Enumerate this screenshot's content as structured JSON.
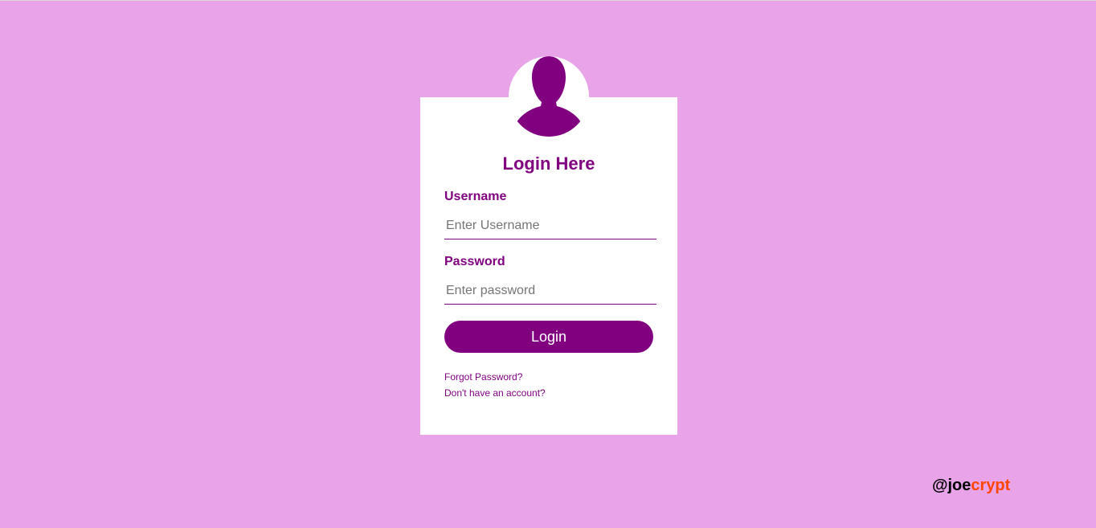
{
  "colors": {
    "background": "#e9a3e9",
    "card": "#ffffff",
    "accent": "#800080",
    "watermark_accent": "#ff4500"
  },
  "avatar": {
    "icon": "user-silhouette-icon"
  },
  "form": {
    "title": "Login Here",
    "username": {
      "label": "Username",
      "value": "",
      "placeholder": "Enter Username"
    },
    "password": {
      "label": "Password",
      "value": "",
      "placeholder": "Enter password"
    },
    "login_label": "Login",
    "forgot_password": "Forgot Password?",
    "signup": "Don't have an account?"
  },
  "watermark": {
    "prefix": "@joe",
    "accent": "crypt"
  }
}
